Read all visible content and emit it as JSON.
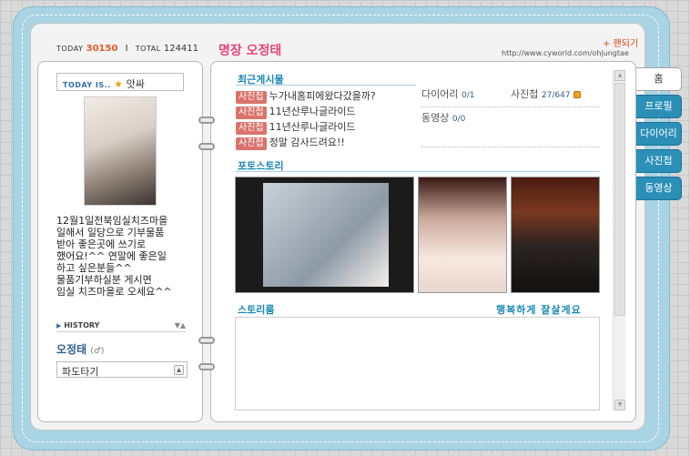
{
  "counter": {
    "today_label": "TODAY",
    "today_value": "30150",
    "separator": "I",
    "total_label": "TOTAL",
    "total_value": "124411"
  },
  "header": {
    "title": "명장 오정태",
    "fandom_label": "+ 팬되기",
    "url": "http://www.cyworld.com/ohjungtae"
  },
  "profile": {
    "today_is_label": "TODAY IS..",
    "mood": "앗싸",
    "intro": "12월1일전북임실치즈마을\n일해서 일당으로 기부물품\n받아 좋은곳에 쓰기로\n했어요!^^ 연말에 좋은일\n하고 싶은분들^^\n물품기부하실분 게시면\n임실 치즈마을로 오세요^^",
    "history_label": "HISTORY",
    "owner_name": "오정태",
    "owner_gender": "(♂)",
    "wave_select": "파도타기"
  },
  "recent": {
    "title": "최근게시물",
    "posts": [
      {
        "badge": "사진첩",
        "text": "누가내홈피에왔다갔을까?"
      },
      {
        "badge": "사진첩",
        "text": "11년산루나글라이드"
      },
      {
        "badge": "사진첩",
        "text": "11년산루나글라이드"
      },
      {
        "badge": "사진첩",
        "text": "정말 감사드려요!!"
      }
    ]
  },
  "stats": {
    "diary_label": "다이어리",
    "diary_count": "0/1",
    "photo_label": "사진첩",
    "photo_count": "27/647",
    "video_label": "동영상",
    "video_count": "0/0"
  },
  "photo_story": {
    "title": "포토스토리"
  },
  "story_room": {
    "title": "스토리룸",
    "subtitle": "행복하게 잘살게요"
  },
  "tabs": [
    {
      "label": "홈"
    },
    {
      "label": "프로필"
    },
    {
      "label": "다이어리"
    },
    {
      "label": "사진첩"
    },
    {
      "label": "동영상"
    }
  ],
  "colors": {
    "cover": "#a9d4e3",
    "tab": "#2b8fb8",
    "section_title": "#1a8ab8",
    "badge": "#d9736b",
    "title": "#e5457d"
  }
}
